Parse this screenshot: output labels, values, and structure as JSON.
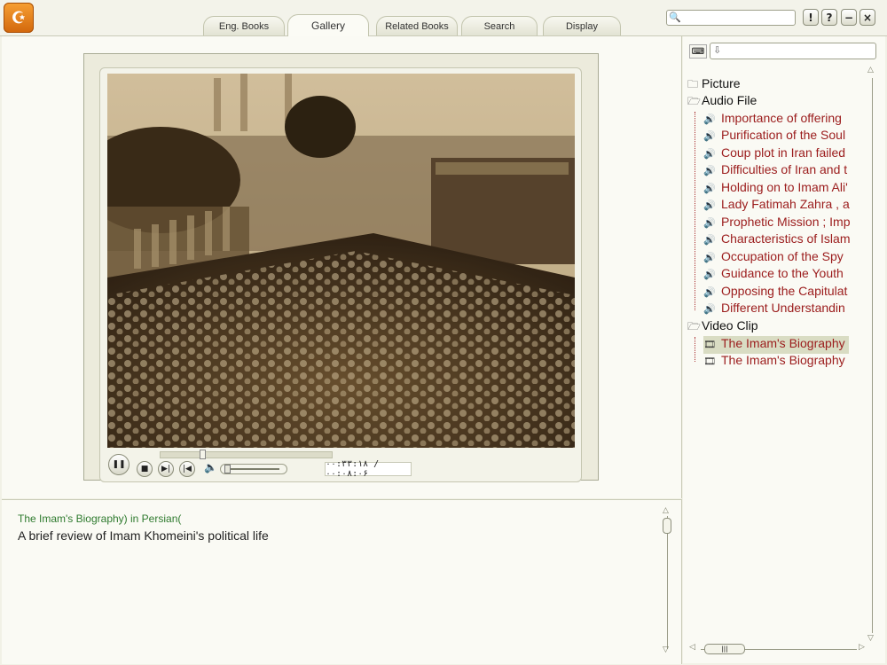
{
  "app": {
    "logo_glyph": "☪"
  },
  "tabs": [
    {
      "label": "Eng. Books",
      "active": false
    },
    {
      "label": "Gallery",
      "active": true
    },
    {
      "label": "Related Books",
      "active": false
    },
    {
      "label": "Search",
      "active": false
    },
    {
      "label": "Display",
      "active": false
    }
  ],
  "header": {
    "search_value": "",
    "buttons": {
      "warning": "!",
      "help": "?",
      "minimize": "−",
      "close": "×"
    }
  },
  "player": {
    "time_text": "۰۰:۳۳:۱۸ / ۰۰:۰۸:۰۶",
    "seek_progress": 0.24,
    "volume_level": 0.05,
    "state": "playing",
    "icons": {
      "pause": "❚❚",
      "stop": "■",
      "next": "▶|",
      "prev": "|◀",
      "volume": "🔈"
    }
  },
  "description": {
    "title": "The Imam's Biography) in Persian(",
    "text": "A brief review of Imam Khomeini's political life"
  },
  "sidebar": {
    "filter_value": "",
    "tree": {
      "picture": {
        "label": "Picture"
      },
      "audio": {
        "label": "Audio File",
        "items": [
          "Importance of offering",
          "Purification of the Soul",
          "Coup plot in Iran failed",
          "Difficulties of Iran and t",
          "Holding on to Imam Ali'",
          "Lady Fatimah Zahra , a",
          "Prophetic Mission ; Imp",
          "Characteristics of Islam",
          "Occupation of the Spy",
          "Guidance to the Youth",
          "Opposing the Capitulat",
          "Different Understandin"
        ]
      },
      "video": {
        "label": "Video Clip",
        "items": [
          {
            "label": "The Imam's Biography",
            "selected": true
          },
          {
            "label": "The Imam's Biography",
            "selected": false
          }
        ]
      }
    }
  },
  "colors": {
    "accent_green": "#2e7a2e",
    "link_red": "#9b1c1c",
    "selection": "#d9dcc3"
  }
}
